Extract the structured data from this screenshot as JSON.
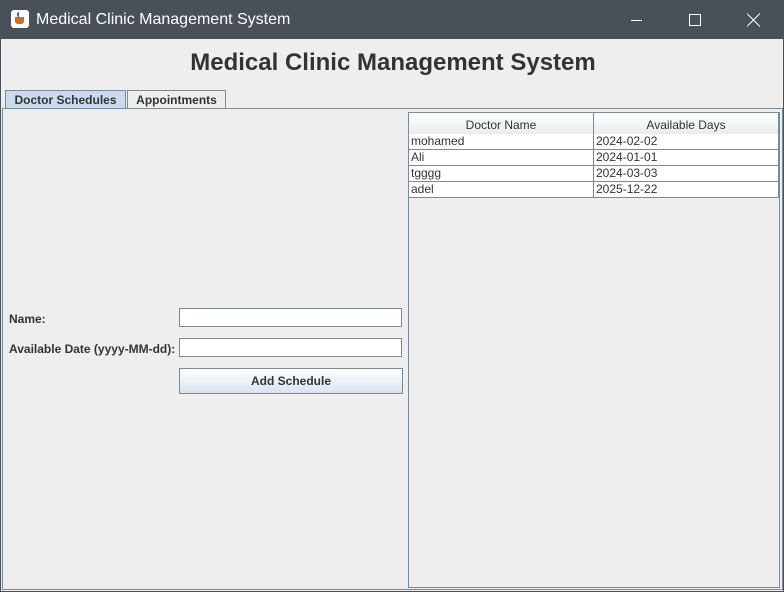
{
  "window": {
    "title": "Medical Clinic Management System"
  },
  "header": {
    "title": "Medical Clinic Management System"
  },
  "tabs": [
    {
      "label": "Doctor Schedules",
      "active": true
    },
    {
      "label": "Appointments",
      "active": false
    }
  ],
  "form": {
    "name_label": "Name:",
    "name_value": "",
    "date_label": "Available Date (yyyy-MM-dd):",
    "date_value": "",
    "submit_label": "Add Schedule"
  },
  "table": {
    "columns": [
      "Doctor Name",
      "Available Days"
    ],
    "rows": [
      [
        "mohamed",
        "2024-02-02"
      ],
      [
        "Ali",
        "2024-01-01"
      ],
      [
        "tgggg",
        "2024-03-03"
      ],
      [
        "adel",
        "2025-12-22"
      ]
    ]
  },
  "colors": {
    "titlebar": "#495058",
    "active_tab": "#c9dcef",
    "border": "#7a8a99"
  }
}
